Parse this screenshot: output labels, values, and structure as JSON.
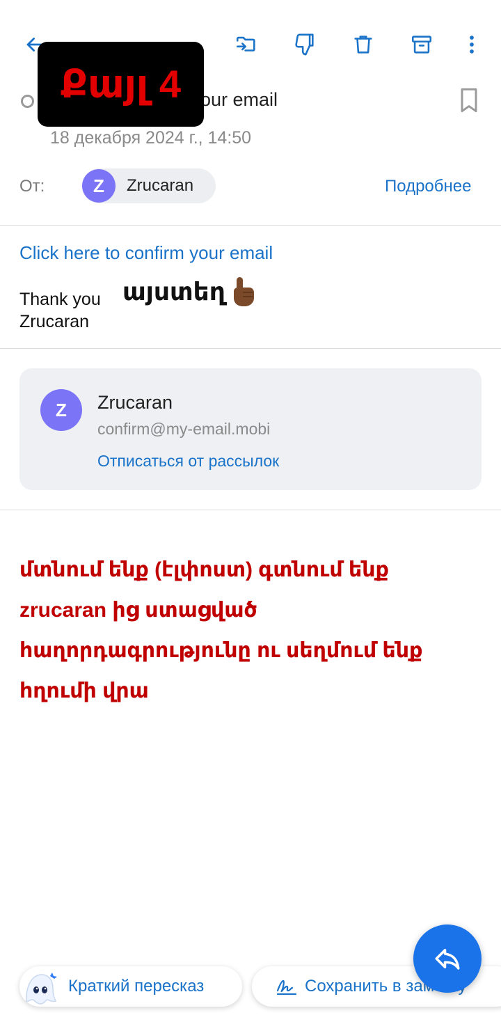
{
  "toolbar": {
    "icons": [
      "back-arrow-icon",
      "move-to-folder-icon",
      "thumbs-down-icon",
      "trash-icon",
      "archive-icon",
      "more-vertical-icon"
    ]
  },
  "overlay": {
    "step_label": "Քայլ 4"
  },
  "message": {
    "subject_visible": "our email",
    "date": "18 декабря 2024 г., 14:50",
    "from_label": "От:",
    "sender_initial": "Z",
    "sender_name": "Zrucaran",
    "details_link": "Подробнее"
  },
  "body": {
    "confirm_link": "Click here to confirm your email",
    "thanks_line1": "Thank you",
    "thanks_line2": "Zrucaran",
    "annotation_here": "այստեղ",
    "annotation_emoji": "pointing-up-hand-icon"
  },
  "sender_card": {
    "initial": "Z",
    "name": "Zrucaran",
    "email": "confirm@my-email.mobi",
    "unsubscribe": "Отписаться от рассылок"
  },
  "instructions": {
    "text": "մտնում ենք (էլփոստ) գտնում ենք zrucaran ից ստացված հաղորդագրությունը  ու սեղմում ենք հղումի վրա"
  },
  "bottom_bar": {
    "summary_label": "Краткий пересказ",
    "save_label": "Сохранить в заметку"
  },
  "colors": {
    "accent": "#1a73c9",
    "avatar": "#7c74f6",
    "annotation_red": "#c00000",
    "fab": "#1a73e8"
  }
}
